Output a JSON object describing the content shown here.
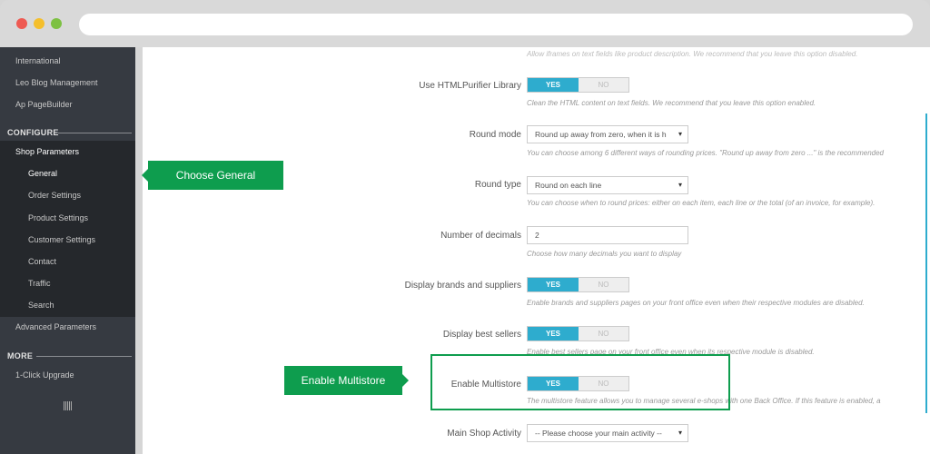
{
  "sidebar": {
    "top_items": [
      "International",
      "Leo Blog Management",
      "Ap PageBuilder"
    ],
    "configure_label": "CONFIGURE",
    "shop_parameters": "Shop Parameters",
    "sub_items": [
      "General",
      "Order Settings",
      "Product Settings",
      "Customer Settings",
      "Contact",
      "Traffic",
      "Search"
    ],
    "advanced_parameters": "Advanced Parameters",
    "more_label": "MORE",
    "upgrade": "1-Click Upgrade"
  },
  "form": {
    "top_help": "Allow iframes on text fields like product description. We recommend that you leave this option disabled.",
    "htmlpurifier": {
      "label": "Use HTMLPurifier Library",
      "yes": "YES",
      "no": "NO",
      "help": "Clean the HTML content on text fields. We recommend that you leave this option enabled."
    },
    "round_mode": {
      "label": "Round mode",
      "value": "Round up away from zero, when it is h",
      "help": "You can choose among 6 different ways of rounding prices. \"Round up away from zero ...\" is the recommended"
    },
    "round_type": {
      "label": "Round type",
      "value": "Round on each line",
      "help": "You can choose when to round prices: either on each item, each line or the total (of an invoice, for example)."
    },
    "decimals": {
      "label": "Number of decimals",
      "value": "2",
      "help": "Choose how many decimals you want to display"
    },
    "brands": {
      "label": "Display brands and suppliers",
      "yes": "YES",
      "no": "NO",
      "help": "Enable brands and suppliers pages on your front office even when their respective modules are disabled."
    },
    "best_sellers": {
      "label": "Display best sellers",
      "yes": "YES",
      "no": "NO",
      "help": "Enable best sellers page on your front office even when its respective module is disabled."
    },
    "multistore": {
      "label": "Enable Multistore",
      "yes": "YES",
      "no": "NO",
      "help": "The multistore feature allows you to manage several e-shops with one Back Office. If this feature is enabled, a"
    },
    "main_activity": {
      "label": "Main Shop Activity",
      "value": "-- Please choose your main activity --"
    }
  },
  "callouts": {
    "general": "Choose General",
    "multistore": "Enable Multistore"
  },
  "colors": {
    "accent": "#2eacce",
    "callout": "#0e9d4e",
    "sidebar": "#363a41"
  }
}
